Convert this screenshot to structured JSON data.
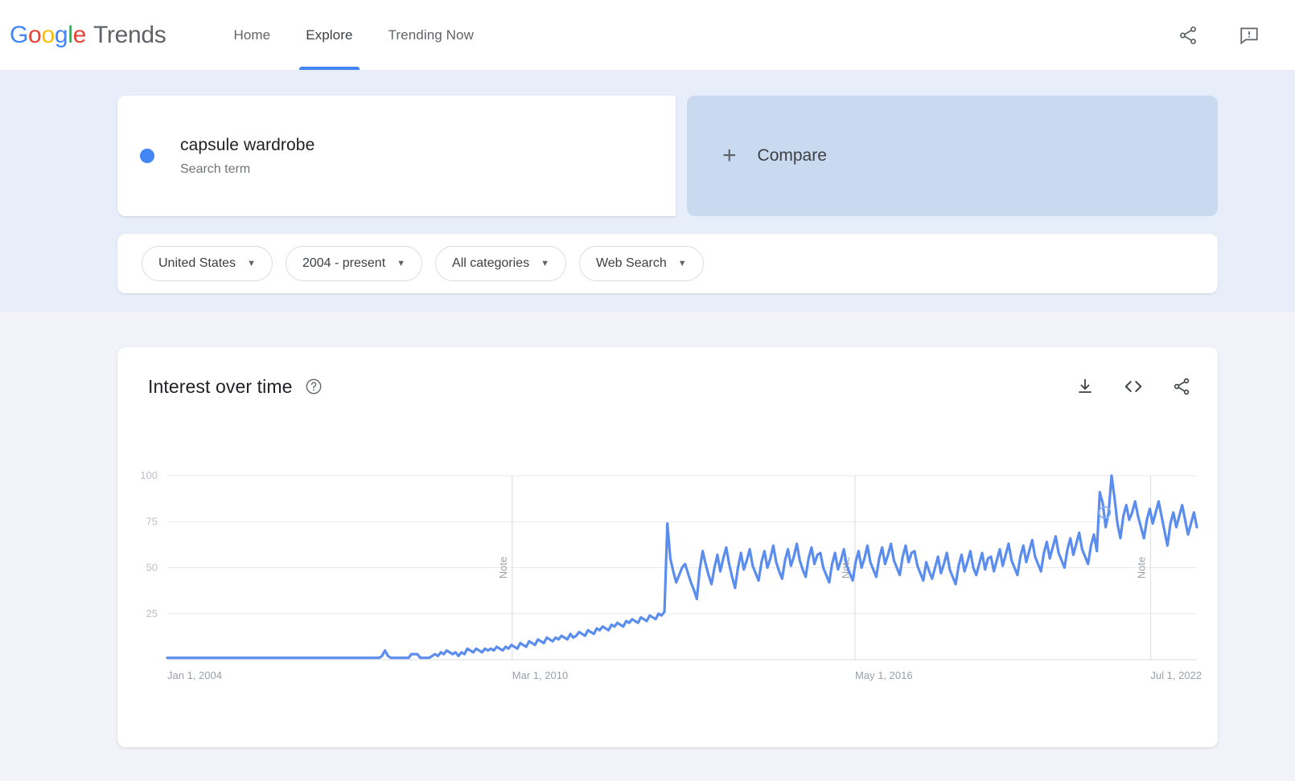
{
  "header": {
    "brand": {
      "g1": "G",
      "o1": "o",
      "o2": "o",
      "g2": "g",
      "l": "l",
      "e": "e",
      "trends": "Trends"
    },
    "nav": [
      {
        "label": "Home",
        "active": false
      },
      {
        "label": "Explore",
        "active": true
      },
      {
        "label": "Trending Now",
        "active": false
      }
    ],
    "icons": {
      "share": "share-icon",
      "feedback": "feedback-icon"
    }
  },
  "query": {
    "term": {
      "title": "capsule wardrobe",
      "subtitle": "Search term",
      "color": "#4285F4"
    },
    "compare": {
      "label": "Compare",
      "plus": "+"
    }
  },
  "filters": [
    {
      "label": "United States"
    },
    {
      "label": "2004 - present"
    },
    {
      "label": "All categories"
    },
    {
      "label": "Web Search"
    }
  ],
  "chart_card": {
    "title": "Interest over time",
    "help_icon": "help-circle-icon",
    "tools": [
      {
        "name": "download-icon"
      },
      {
        "name": "embed-code-icon"
      },
      {
        "name": "share-icon"
      }
    ]
  },
  "chart_data": {
    "type": "line",
    "title": "Interest over time",
    "xlabel": "",
    "ylabel": "",
    "series_name": "capsule wardrobe",
    "color": "#5b8def",
    "ylim": [
      0,
      100
    ],
    "yticks": [
      100,
      75,
      50,
      25
    ],
    "grid": true,
    "legend": "none",
    "xticks": [
      "Jan 1, 2004",
      "Mar 1, 2010",
      "May 1, 2016",
      "Jul 1, 2022"
    ],
    "xtick_positions": [
      0,
      0.335,
      0.668,
      0.955
    ],
    "annotations": [
      {
        "label": "Note",
        "x": 0.335
      },
      {
        "label": "Note",
        "x": 0.668
      },
      {
        "label": "Note",
        "x": 0.955
      }
    ],
    "hover_marker": {
      "x": 0.9105,
      "y": 80
    },
    "values": [
      1,
      1,
      1,
      1,
      1,
      1,
      1,
      1,
      1,
      1,
      1,
      1,
      1,
      1,
      1,
      1,
      1,
      1,
      1,
      1,
      1,
      1,
      1,
      1,
      1,
      1,
      1,
      1,
      1,
      1,
      1,
      1,
      1,
      1,
      1,
      1,
      1,
      1,
      1,
      1,
      1,
      1,
      1,
      1,
      1,
      1,
      1,
      1,
      1,
      1,
      1,
      1,
      1,
      1,
      1,
      1,
      1,
      1,
      1,
      1,
      1,
      1,
      1,
      1,
      1,
      1,
      1,
      1,
      1,
      1,
      1,
      1,
      1,
      2,
      5,
      2,
      1,
      1,
      1,
      1,
      1,
      1,
      1,
      3,
      3,
      3,
      1,
      1,
      1,
      1,
      2,
      3,
      2,
      4,
      3,
      5,
      4,
      3,
      4,
      2,
      4,
      3,
      6,
      5,
      4,
      6,
      5,
      4,
      6,
      5,
      6,
      5,
      7,
      6,
      5,
      7,
      6,
      8,
      7,
      6,
      9,
      8,
      7,
      10,
      9,
      8,
      11,
      10,
      9,
      12,
      11,
      10,
      12,
      11,
      13,
      12,
      11,
      14,
      12,
      13,
      15,
      14,
      13,
      16,
      15,
      14,
      17,
      16,
      18,
      17,
      16,
      19,
      18,
      20,
      19,
      18,
      21,
      20,
      22,
      21,
      20,
      23,
      22,
      21,
      24,
      23,
      22,
      25,
      24,
      26,
      74,
      55,
      48,
      42,
      46,
      50,
      52,
      47,
      42,
      38,
      33,
      49,
      59,
      52,
      46,
      41,
      50,
      57,
      48,
      55,
      61,
      52,
      45,
      39,
      50,
      58,
      49,
      54,
      60,
      51,
      47,
      43,
      53,
      59,
      50,
      55,
      62,
      53,
      48,
      44,
      54,
      60,
      51,
      56,
      63,
      54,
      49,
      45,
      55,
      61,
      52,
      57,
      58,
      50,
      46,
      42,
      52,
      58,
      49,
      54,
      60,
      51,
      47,
      43,
      53,
      59,
      50,
      55,
      62,
      53,
      49,
      45,
      55,
      61,
      52,
      57,
      63,
      54,
      50,
      46,
      56,
      62,
      53,
      58,
      59,
      51,
      47,
      43,
      53,
      48,
      44,
      50,
      56,
      47,
      52,
      58,
      49,
      45,
      41,
      51,
      57,
      48,
      53,
      59,
      50,
      46,
      52,
      58,
      49,
      55,
      56,
      48,
      54,
      60,
      51,
      57,
      63,
      54,
      50,
      46,
      56,
      62,
      53,
      59,
      65,
      56,
      52,
      48,
      58,
      64,
      55,
      61,
      67,
      58,
      54,
      50,
      60,
      66,
      57,
      63,
      69,
      60,
      56,
      52,
      62,
      68,
      59,
      91,
      85,
      72,
      80,
      100,
      88,
      74,
      66,
      78,
      84,
      76,
      80,
      86,
      78,
      72,
      66,
      76,
      82,
      74,
      80,
      86,
      78,
      70,
      62,
      74,
      80,
      72,
      78,
      84,
      76,
      68,
      74,
      80,
      72
    ]
  }
}
